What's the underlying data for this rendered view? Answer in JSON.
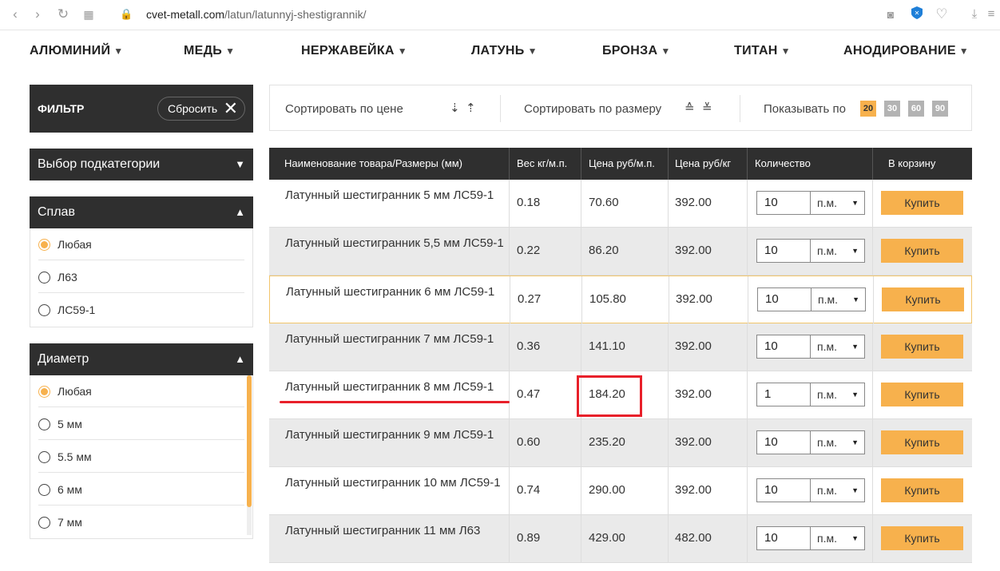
{
  "browser": {
    "url_host": "cvet-metall.com",
    "url_path": "/latun/latunnyj-shestigrannik/"
  },
  "nav": {
    "items": [
      {
        "label": "АЛЮМИНИЙ"
      },
      {
        "label": "МЕДЬ"
      },
      {
        "label": "НЕРЖАВЕЙКА"
      },
      {
        "label": "ЛАТУНЬ"
      },
      {
        "label": "БРОНЗА"
      },
      {
        "label": "ТИТАН"
      },
      {
        "label": "АНОДИРОВАНИЕ"
      }
    ]
  },
  "filter": {
    "title": "ФИЛЬТР",
    "reset_label": "Сбросить",
    "subcategory_label": "Выбор подкатегории",
    "alloy": {
      "title": "Сплав",
      "options": [
        "Любая",
        "Л63",
        "ЛС59-1"
      ],
      "selected": 0
    },
    "diameter": {
      "title": "Диаметр",
      "options": [
        "Любая",
        "5 мм",
        "5.5 мм",
        "6 мм",
        "7 мм"
      ],
      "selected": 0
    }
  },
  "sortbar": {
    "sort_price": "Сортировать по цене",
    "sort_size": "Сортировать по размеру",
    "show_by": "Показывать по",
    "page_sizes": [
      "20",
      "30",
      "60",
      "90"
    ],
    "page_size_selected": 0
  },
  "table": {
    "headers": {
      "name": "Наименование товара/Размеры (мм)",
      "weight": "Вес кг/м.п.",
      "price_m": "Цена руб/м.п.",
      "price_kg": "Цена руб/кг",
      "qty": "Количество",
      "cart": "В корзину"
    },
    "unit_label": "п.м.",
    "buy_label": "Купить",
    "rows": [
      {
        "name": "Латунный шестигранник 5 мм ЛС59-1",
        "weight": "0.18",
        "price_m": "70.60",
        "price_kg": "392.00",
        "qty": "10"
      },
      {
        "name": "Латунный шестигранник 5,5 мм ЛС59-1",
        "weight": "0.22",
        "price_m": "86.20",
        "price_kg": "392.00",
        "qty": "10"
      },
      {
        "name": "Латунный шестигранник 6 мм ЛС59-1",
        "weight": "0.27",
        "price_m": "105.80",
        "price_kg": "392.00",
        "qty": "10"
      },
      {
        "name": "Латунный шестигранник 7 мм ЛС59-1",
        "weight": "0.36",
        "price_m": "141.10",
        "price_kg": "392.00",
        "qty": "10"
      },
      {
        "name": "Латунный шестигранник 8 мм ЛС59-1",
        "weight": "0.47",
        "price_m": "184.20",
        "price_kg": "392.00",
        "qty": "1"
      },
      {
        "name": "Латунный шестигранник 9 мм ЛС59-1",
        "weight": "0.60",
        "price_m": "235.20",
        "price_kg": "392.00",
        "qty": "10"
      },
      {
        "name": "Латунный шестигранник 10 мм ЛС59-1",
        "weight": "0.74",
        "price_m": "290.00",
        "price_kg": "392.00",
        "qty": "10"
      },
      {
        "name": "Латунный шестигранник 11 мм Л63",
        "weight": "0.89",
        "price_m": "429.00",
        "price_kg": "482.00",
        "qty": "10"
      }
    ]
  },
  "colors": {
    "accent": "#f7b14d",
    "dark": "#2f2f2f",
    "annotation": "#e8202a"
  }
}
